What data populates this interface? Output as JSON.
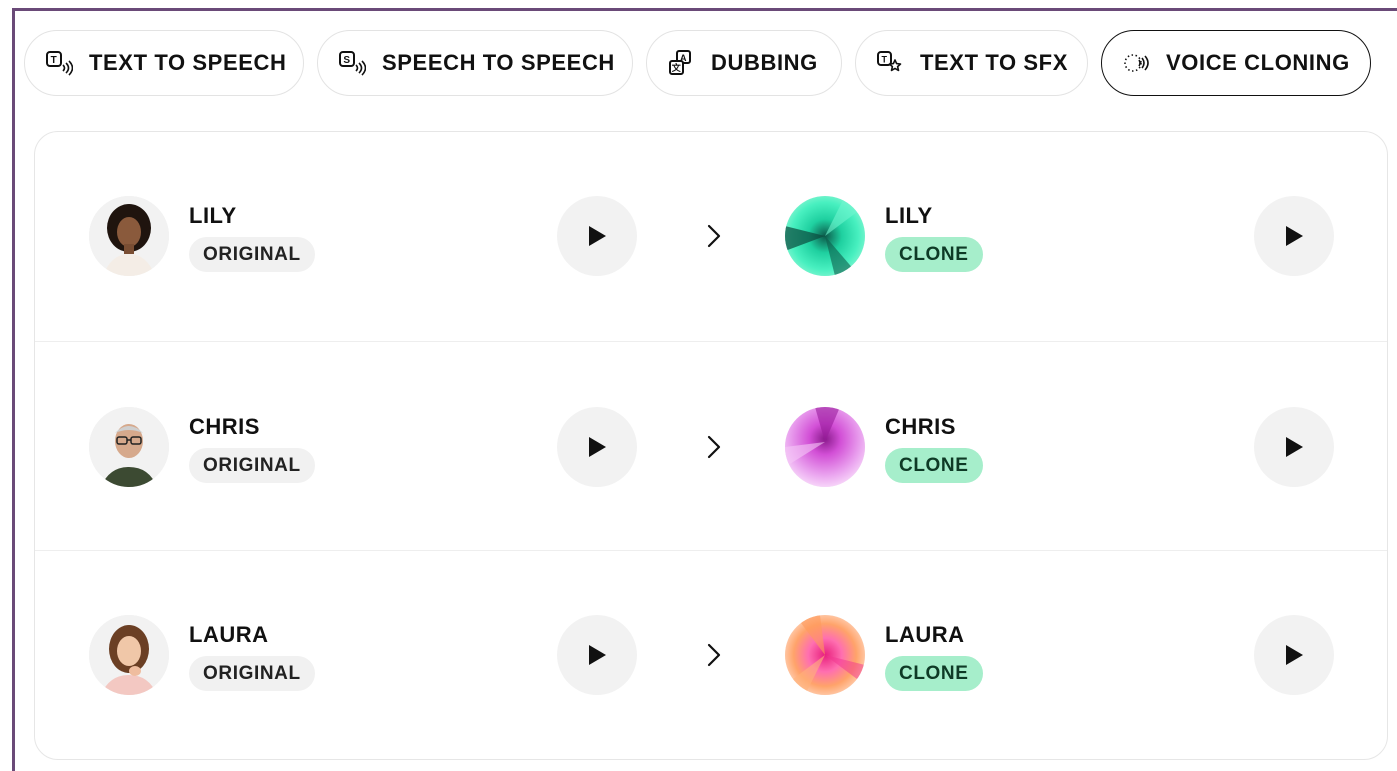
{
  "tabs": [
    {
      "label": "TEXT TO SPEECH",
      "icon": "text-to-speech-icon"
    },
    {
      "label": "SPEECH TO SPEECH",
      "icon": "speech-to-speech-icon"
    },
    {
      "label": "DUBBING",
      "icon": "dubbing-icon"
    },
    {
      "label": "TEXT TO SFX",
      "icon": "text-to-sfx-icon"
    },
    {
      "label": "VOICE CLONING",
      "icon": "voice-cloning-icon",
      "active": true
    }
  ],
  "rows": [
    {
      "original_name": "LILY",
      "original_label": "ORIGINAL",
      "clone_name": "LILY",
      "clone_label": "CLONE"
    },
    {
      "original_name": "CHRIS",
      "original_label": "ORIGINAL",
      "clone_name": "CHRIS",
      "clone_label": "CLONE"
    },
    {
      "original_name": "LAURA",
      "original_label": "ORIGINAL",
      "clone_name": "LAURA",
      "clone_label": "CLONE"
    }
  ],
  "colors": {
    "active_border": "#111111",
    "clone_badge": "#a6eecb",
    "original_badge": "#f1f1f1",
    "frame_accent": "#6a4a78"
  }
}
